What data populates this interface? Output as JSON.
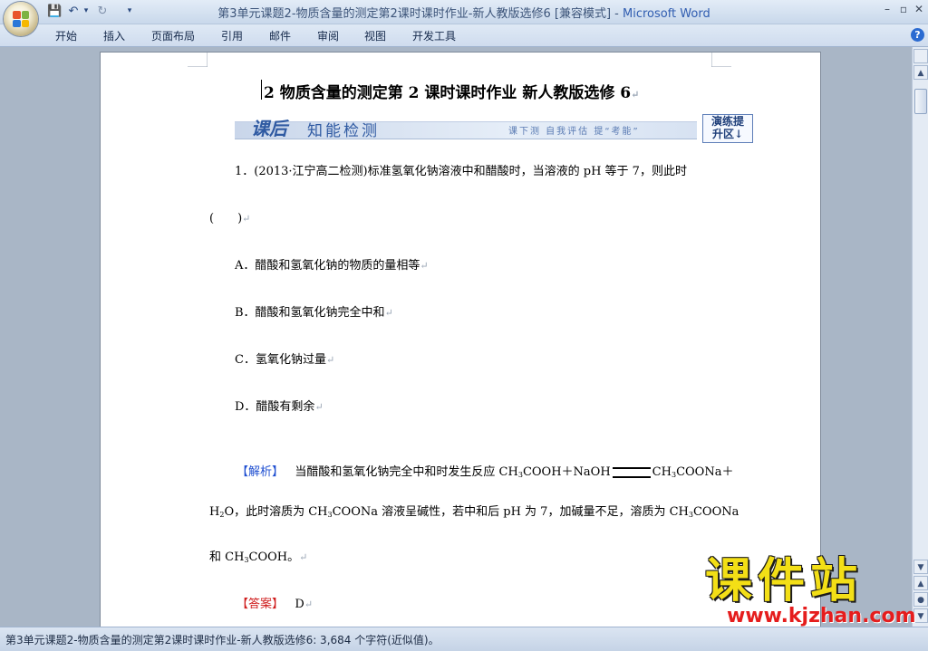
{
  "window": {
    "title_doc": "第3单元课题2-物质含量的测定第2课时课时作业-新人教版选修6 [兼容模式] - ",
    "title_app": "Microsoft Word",
    "minimize": "–",
    "restore": "▫",
    "close": "✕"
  },
  "qat": {
    "save": "💾",
    "undo": "↶",
    "undo_arrow": "▾",
    "redo": "↻",
    "customize": "▾"
  },
  "ribbon": {
    "tabs": [
      "开始",
      "插入",
      "页面布局",
      "引用",
      "邮件",
      "审阅",
      "视图",
      "开发工具"
    ],
    "help": "?"
  },
  "document": {
    "heading": "2  物质含量的测定第 2 课时课时作业  新人教版选修 6",
    "banner": {
      "title_a": "课后",
      "title_b": "知能检测",
      "sub": "课下测  自我评估  提“考能”",
      "badge_line1": "演练提",
      "badge_line2": "升区↓"
    },
    "q1": "1．(2013·江宁高二检测)标准氢氧化钠溶液中和醋酸时，当溶液的 pH 等于 7，则此时",
    "q1_paren": "(　　)",
    "optA": "A．醋酸和氢氧化钠的物质的量相等",
    "optB": "B．醋酸和氢氧化钠完全中和",
    "optC": "C．氢氧化钠过量",
    "optD": "D．醋酸有剩余",
    "analysis_tag": "【解析】",
    "analysis_1a": "当醋酸和氢氧化钠完全中和时发生反应 CH",
    "analysis_1b": "COOH＋NaOH",
    "analysis_1c": "CH",
    "analysis_1d": "COONa＋",
    "analysis_2a": "H",
    "analysis_2b": "O，此时溶质为 CH",
    "analysis_2c": "COONa 溶液呈碱性，若中和后 pH 为 7，加碱量不足，溶质为 CH",
    "analysis_2d": "COONa",
    "analysis_3a": "和 CH",
    "analysis_3b": "COOH。",
    "sub3": "3",
    "sub2": "2",
    "answer_tag": "【答案】",
    "answer": "D",
    "para_mark": "↵"
  },
  "statusbar": {
    "text": "第3单元课题2-物质含量的测定第2课时课时作业-新人教版选修6: 3,684 个字符(近似值)。"
  },
  "watermark": {
    "big": "课件站",
    "url": "www.kjzhan.com"
  },
  "colors": {
    "accent_blue": "#1f4fd1",
    "accent_red": "#cf1c1c",
    "watermark_yellow": "#f3df16"
  }
}
